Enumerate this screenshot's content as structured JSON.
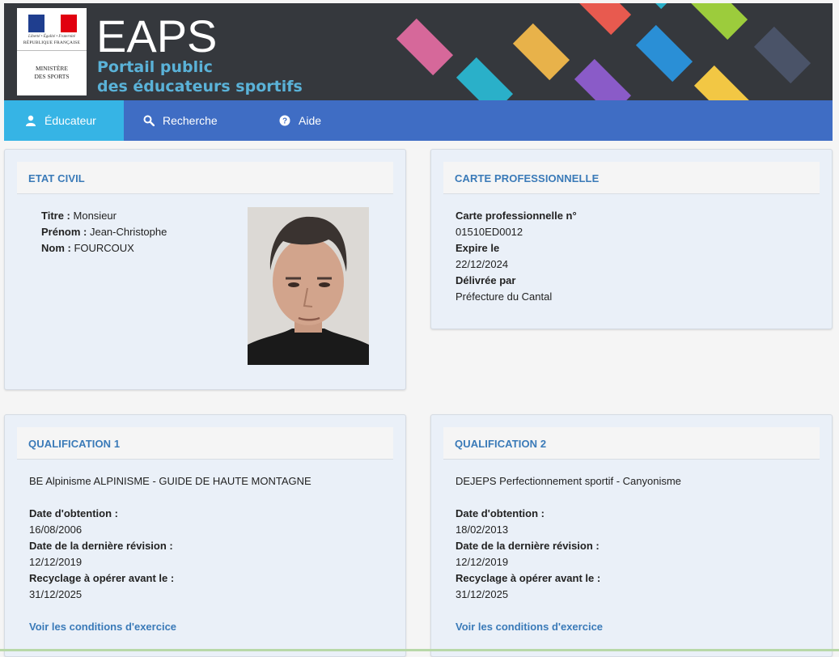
{
  "header": {
    "logo": {
      "motto": "Liberté • Égalité • Fraternité",
      "republic": "RÉPUBLIQUE FRANÇAISE",
      "ministry_line1": "MINISTÈRE",
      "ministry_line2": "DES SPORTS",
      "flag_colors": [
        "#1f3e8f",
        "#ffffff",
        "#e1000f"
      ]
    },
    "title": "EAPS",
    "subtitle_line1": "Portail public",
    "subtitle_line2": "des éducateurs sportifs",
    "tile_colors": [
      "#d6689a",
      "#e85a4f",
      "#e8b24a",
      "#2ab0c9",
      "#9ccc3c",
      "#8a5bc8",
      "#4a5368",
      "#f2c744"
    ]
  },
  "nav": {
    "items": [
      {
        "label": "Éducateur",
        "icon": "user-icon",
        "active": true
      },
      {
        "label": "Recherche",
        "icon": "search-icon",
        "active": false
      },
      {
        "label": "Aide",
        "icon": "help-icon",
        "active": false
      }
    ]
  },
  "etat_civil": {
    "heading": "ETAT CIVIL",
    "titre_label": "Titre :",
    "titre_value": "Monsieur",
    "prenom_label": "Prénom :",
    "prenom_value": "Jean-Christophe",
    "nom_label": "Nom :",
    "nom_value": "FOURCOUX"
  },
  "carte": {
    "heading": "CARTE PROFESSIONNELLE",
    "numero_label": "Carte professionnelle n°",
    "numero_value": "01510ED0012",
    "expire_label": "Expire le",
    "expire_value": "22/12/2024",
    "delivree_label": "Délivrée par",
    "delivree_value": "Préfecture du Cantal"
  },
  "qualifications": [
    {
      "heading": "QUALIFICATION 1",
      "title": "BE Alpinisme ALPINISME - GUIDE DE HAUTE MONTAGNE",
      "obtention_label": "Date d'obtention :",
      "obtention_value": "16/08/2006",
      "revision_label": "Date de la dernière révision :",
      "revision_value": "12/12/2019",
      "recyclage_label": "Recyclage à opérer avant le :",
      "recyclage_value": "31/12/2025",
      "link": "Voir les conditions d'exercice"
    },
    {
      "heading": "QUALIFICATION 2",
      "title": "DEJEPS Perfectionnement sportif - Canyonisme",
      "obtention_label": "Date d'obtention :",
      "obtention_value": "18/02/2013",
      "revision_label": "Date de la dernière révision :",
      "revision_value": "12/12/2019",
      "recyclage_label": "Recyclage à opérer avant le :",
      "recyclage_value": "31/12/2025",
      "link": "Voir les conditions d'exercice"
    }
  ]
}
